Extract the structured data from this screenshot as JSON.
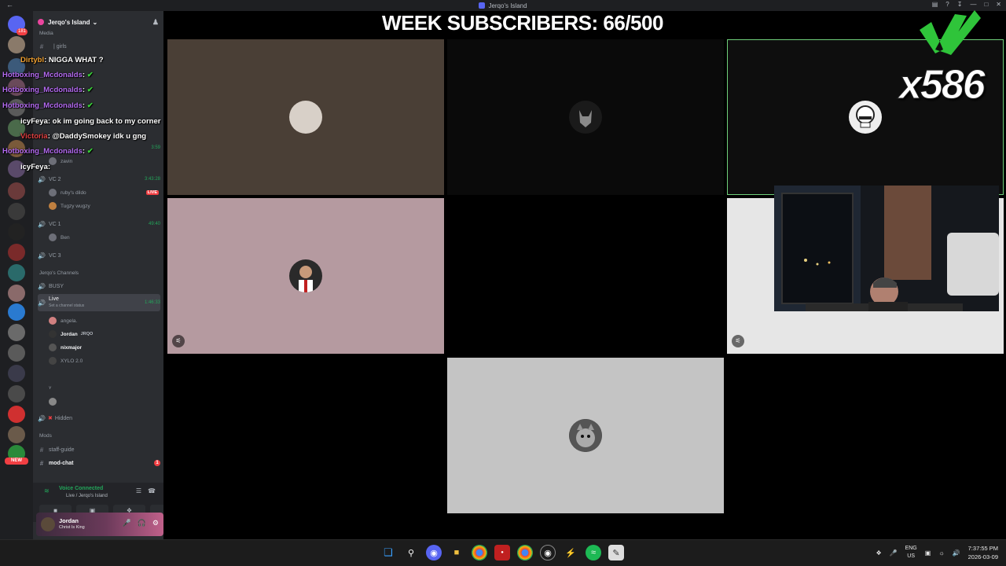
{
  "window": {
    "title": "Jerqo's Island"
  },
  "server": {
    "name": "Jerqo's Island"
  },
  "rail": {
    "top_badge": "181",
    "new_label": "NEW"
  },
  "channels": {
    "media_cat": "Media",
    "girls": "| girls",
    "vc2": "VC 2",
    "vc2_timer": "3:43:28",
    "vc2_users": [
      {
        "name": "ruby's dildo",
        "live": "LIVE"
      },
      {
        "name": "Tugzy wugzy"
      }
    ],
    "vc1": "VC 1",
    "vc1_timer": "49:40",
    "vc1_users": [
      {
        "name": "Ben"
      }
    ],
    "vc3": "VC 3",
    "jerqo_cat": "Jerqo's Channels",
    "busy": "BUSY",
    "live": "Live",
    "live_status": "Set a channel status",
    "live_timer": "1:46:33",
    "live_users": [
      {
        "name": "angela."
      },
      {
        "name": "Jordan",
        "tag": "JRQO"
      },
      {
        "name": "nixmajor"
      },
      {
        "name": "XYLO 2.0"
      }
    ],
    "y_user": "ʏ",
    "hidden": "Hidden",
    "mods_cat": "Mods",
    "staff_guide": "staff-guide",
    "mod_chat": "mod-chat",
    "extra_timer": "3:59",
    "extra_user": "zavin"
  },
  "chat": [
    {
      "name": "Dirtybl",
      "text": ": NIGGA WHAT ?",
      "color": "orange"
    },
    {
      "name": "Hotboxing_Mcdonalds",
      "text": ":",
      "color": "purple",
      "emote": true
    },
    {
      "name": "Hotboxing_Mcdonalds",
      "text": ":",
      "color": "purple",
      "emote": true
    },
    {
      "name": "Hotboxing_Mcdonalds",
      "text": ":",
      "color": "purple",
      "emote": true
    },
    {
      "name": "icyFeya",
      "text": ": ok im going back to my corner",
      "color": "white"
    },
    {
      "name": "Victoria",
      "text": ": @DaddySmokey idk u gng",
      "color": "red"
    },
    {
      "name": "Hotboxing_Mcdonalds",
      "text": ":",
      "color": "purple",
      "emote": true
    },
    {
      "name": "icyFeya",
      "text": ":",
      "color": "white"
    }
  ],
  "voice": {
    "status": "Voice Connected",
    "location": "Live / Jerqo's Island"
  },
  "user": {
    "name": "Jordan",
    "status": "Christ Is King"
  },
  "stage": {
    "title": "WEEK SUBSCRIBERS: 66/500",
    "emote_count": "x586"
  },
  "tiles": [
    {
      "bg": "#4a3f36"
    },
    {
      "bg": "#0a0a0a"
    },
    {
      "bg": "#0e0e0e",
      "border": "#6fcf7a"
    },
    {
      "bg": "#b59aa0"
    },
    {
      "bg": "#000000"
    },
    {
      "bg": "#e6e6e6"
    },
    {
      "bg": "#c4c4c4"
    }
  ],
  "taskbar": {
    "lang1": "ENG",
    "lang2": "US",
    "time": "7:37:55 PM",
    "date": "2026-03-09"
  }
}
